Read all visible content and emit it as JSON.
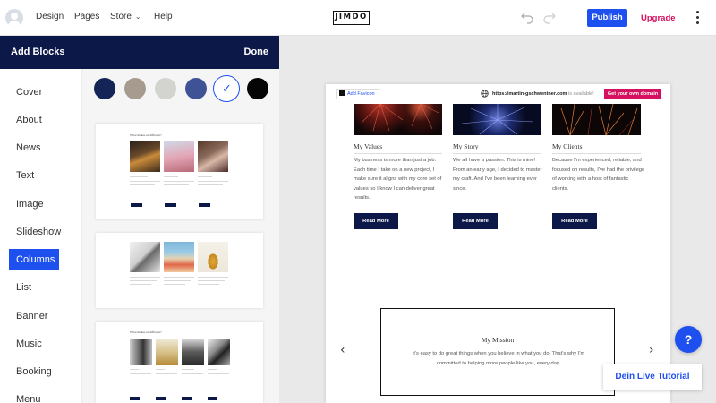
{
  "topbar": {
    "nav": [
      "Design",
      "Pages",
      "Store",
      "Help"
    ],
    "logo": "JIMDO",
    "publish": "Publish",
    "upgrade": "Upgrade"
  },
  "panel": {
    "title": "Add Blocks",
    "done": "Done",
    "categories": [
      "Cover",
      "About",
      "News",
      "Text",
      "Image",
      "Slideshow",
      "Columns",
      "List",
      "Banner",
      "Music",
      "Booking",
      "Menu"
    ],
    "active_category": "Columns",
    "swatches": [
      "#142456",
      "#a79a8f",
      "#d3d3cf",
      "#3f5296",
      "#ffffff",
      "#050505"
    ],
    "selected_swatch": 4,
    "card_heading": "What makes us different?"
  },
  "canvas": {
    "add_favicon": "Add Favicon",
    "domain": "https://martin-gschwentner.com",
    "domain_status": "is available!",
    "domain_button": "Get your own domain",
    "columns": [
      {
        "title": "My Values",
        "text": "My business is more than just a job. Each time I take on a new project, I make sure it aligns with my core set of values so I know I can deliver great results.",
        "button": "Read More"
      },
      {
        "title": "My Story",
        "text": "We all have a passion. This is mine! From an early age, I decided to master my craft. And I've been learning ever since.",
        "button": "Read More"
      },
      {
        "title": "My Clients",
        "text": "Because I'm experienced, reliable, and focused on results, I've had the privilege of working with a host of fantastic clients.",
        "button": "Read More"
      }
    ],
    "mission": {
      "title": "My Mission",
      "text": "It's easy to do great things when you believe in what you do. That's why I'm committed to helping more people like you, every day."
    },
    "prev_arrow": "‹",
    "next_arrow": "›"
  },
  "help": {
    "label": "?",
    "tutorial": "Dein Live Tutorial"
  },
  "colors": {
    "brand_blue": "#1e50ef",
    "navy": "#0c1848",
    "pink": "#d5105f"
  }
}
